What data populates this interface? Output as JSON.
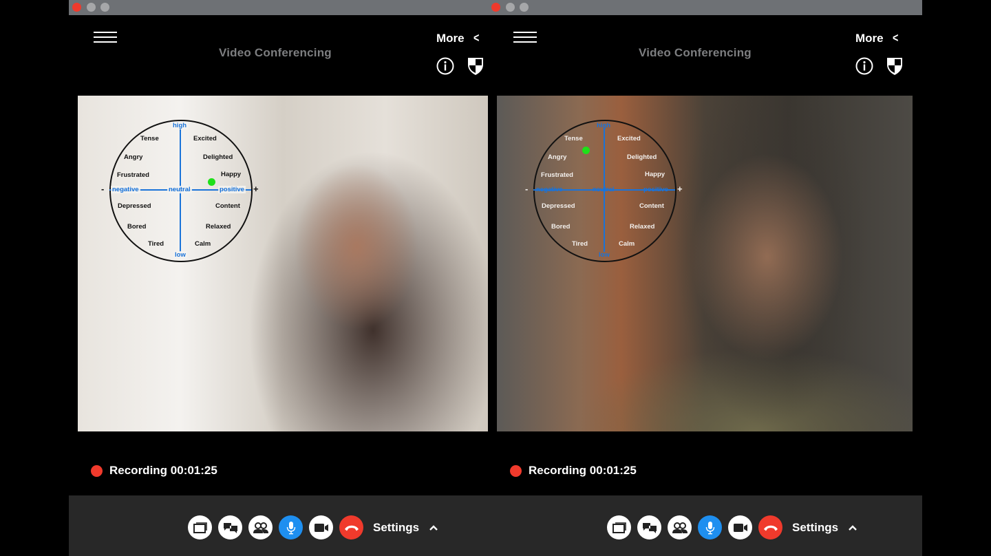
{
  "windows": [
    {
      "id": "left",
      "app_title": "Video Conferencing",
      "more_label": "More",
      "video": {
        "participant": "woman-with-earphones",
        "emotion_wheel": {
          "axis": {
            "high": "high",
            "low": "low",
            "negative": "negative",
            "neutral": "neutral",
            "positive": "positive",
            "minus": "-",
            "plus": "+"
          },
          "emotions": [
            "Tense",
            "Excited",
            "Angry",
            "Delighted",
            "Frustrated",
            "Happy",
            "Depressed",
            "Content",
            "Bored",
            "Relaxed",
            "Tired",
            "Calm"
          ],
          "marker": {
            "valence": 0.45,
            "arousal": 0.12,
            "nearest_emotion": "Happy"
          },
          "marker_color": "#1fe01a"
        }
      },
      "recording": {
        "label": "Recording",
        "time": "00:01:25",
        "text": "Recording 00:01:25"
      },
      "controls": {
        "buttons": [
          "screen-share",
          "chat",
          "participants",
          "microphone",
          "camera",
          "end-call"
        ],
        "settings_label": "Settings"
      }
    },
    {
      "id": "right",
      "app_title": "Video Conferencing",
      "more_label": "More",
      "video": {
        "participant": "man-in-camouflage",
        "emotion_wheel": {
          "axis": {
            "high": "high",
            "low": "low",
            "negative": "negative",
            "neutral": "neutral",
            "positive": "positive",
            "minus": "-",
            "plus": "+"
          },
          "emotions": [
            "Tense",
            "Excited",
            "Angry",
            "Delighted",
            "Frustrated",
            "Happy",
            "Depressed",
            "Content",
            "Bored",
            "Relaxed",
            "Tired",
            "Calm"
          ],
          "marker": {
            "valence": -0.27,
            "arousal": 0.58,
            "nearest_emotion": "Tense"
          },
          "marker_color": "#1fe01a"
        }
      },
      "recording": {
        "label": "Recording",
        "time": "00:01:25",
        "text": "Recording 00:01:25"
      },
      "controls": {
        "buttons": [
          "screen-share",
          "chat",
          "participants",
          "microphone",
          "camera",
          "end-call"
        ],
        "settings_label": "Settings"
      }
    }
  ],
  "colors": {
    "titlebar": "#6e7175",
    "close_dot": "#f03a2c",
    "inactive_dot": "#a6a7a9",
    "title_text": "#7d7e80",
    "axis_blue": "#1a73d9",
    "mic_active": "#1e8ff0",
    "end_call": "#f03a2c",
    "control_bar": "#282828"
  }
}
